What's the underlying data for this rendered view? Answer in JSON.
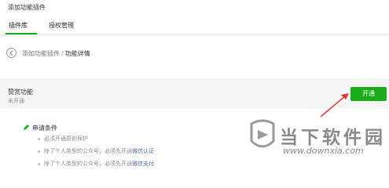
{
  "page_title": "添加功能插件",
  "tabs": [
    {
      "label": "插件库"
    },
    {
      "label": "授权管理"
    }
  ],
  "breadcrumb": {
    "parent": "添加功能插件",
    "separator": "/",
    "current": "功能详情"
  },
  "feature": {
    "name": "赞赏功能",
    "status": "未开通",
    "enable_button": "开通"
  },
  "requirements": {
    "title": "申请条件",
    "items": [
      {
        "text": "必须开通原创保护",
        "link": ""
      },
      {
        "text": "除了个人类型的公众号，必须先开通",
        "link": "微信认证"
      },
      {
        "text": "除了个人类型的公众号，必须先开通",
        "link": "微信支付"
      }
    ]
  },
  "watermark": {
    "text": "当下软件园",
    "url": "www.downxia.com"
  },
  "colors": {
    "accent": "#1aad19",
    "annotation_arrow": "#e03a2e",
    "link": "#4a6ca5"
  }
}
